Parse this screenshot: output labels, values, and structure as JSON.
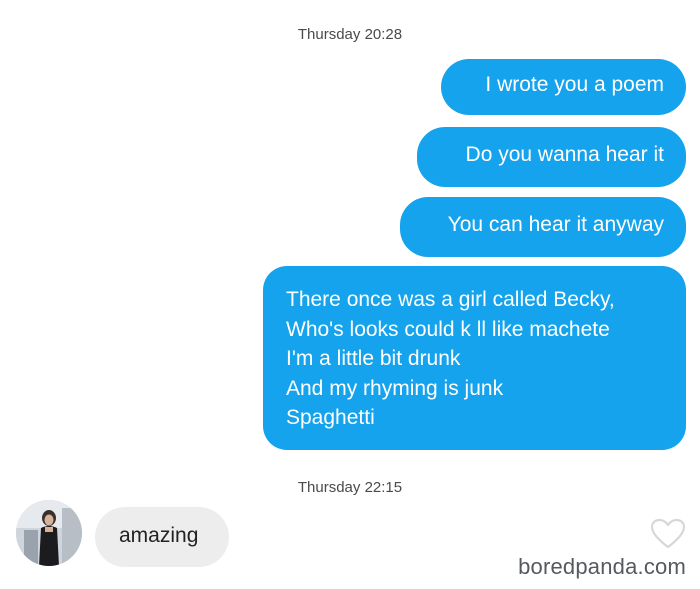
{
  "conversation": {
    "timestamps": [
      "Thursday 20:28",
      "Thursday 22:15"
    ],
    "outgoing": [
      {
        "text": "I wrote you a poem"
      },
      {
        "text": "Do you wanna hear it"
      },
      {
        "text": "You can hear it anyway"
      },
      {
        "lines": [
          "There once was a girl called Becky,",
          "Who's looks could k ll like machete",
          "I'm a little bit drunk",
          "And my rhyming is junk",
          "Spaghetti"
        ]
      }
    ],
    "incoming": [
      {
        "text": "amazing"
      }
    ]
  },
  "icons": {
    "avatar": "contact-avatar",
    "like": "heart-icon"
  },
  "watermark": "boredpanda.com",
  "colors": {
    "outgoing_bubble": "#14a3ec",
    "incoming_bubble": "#ededed",
    "timestamp_text": "#4a4a4a"
  }
}
